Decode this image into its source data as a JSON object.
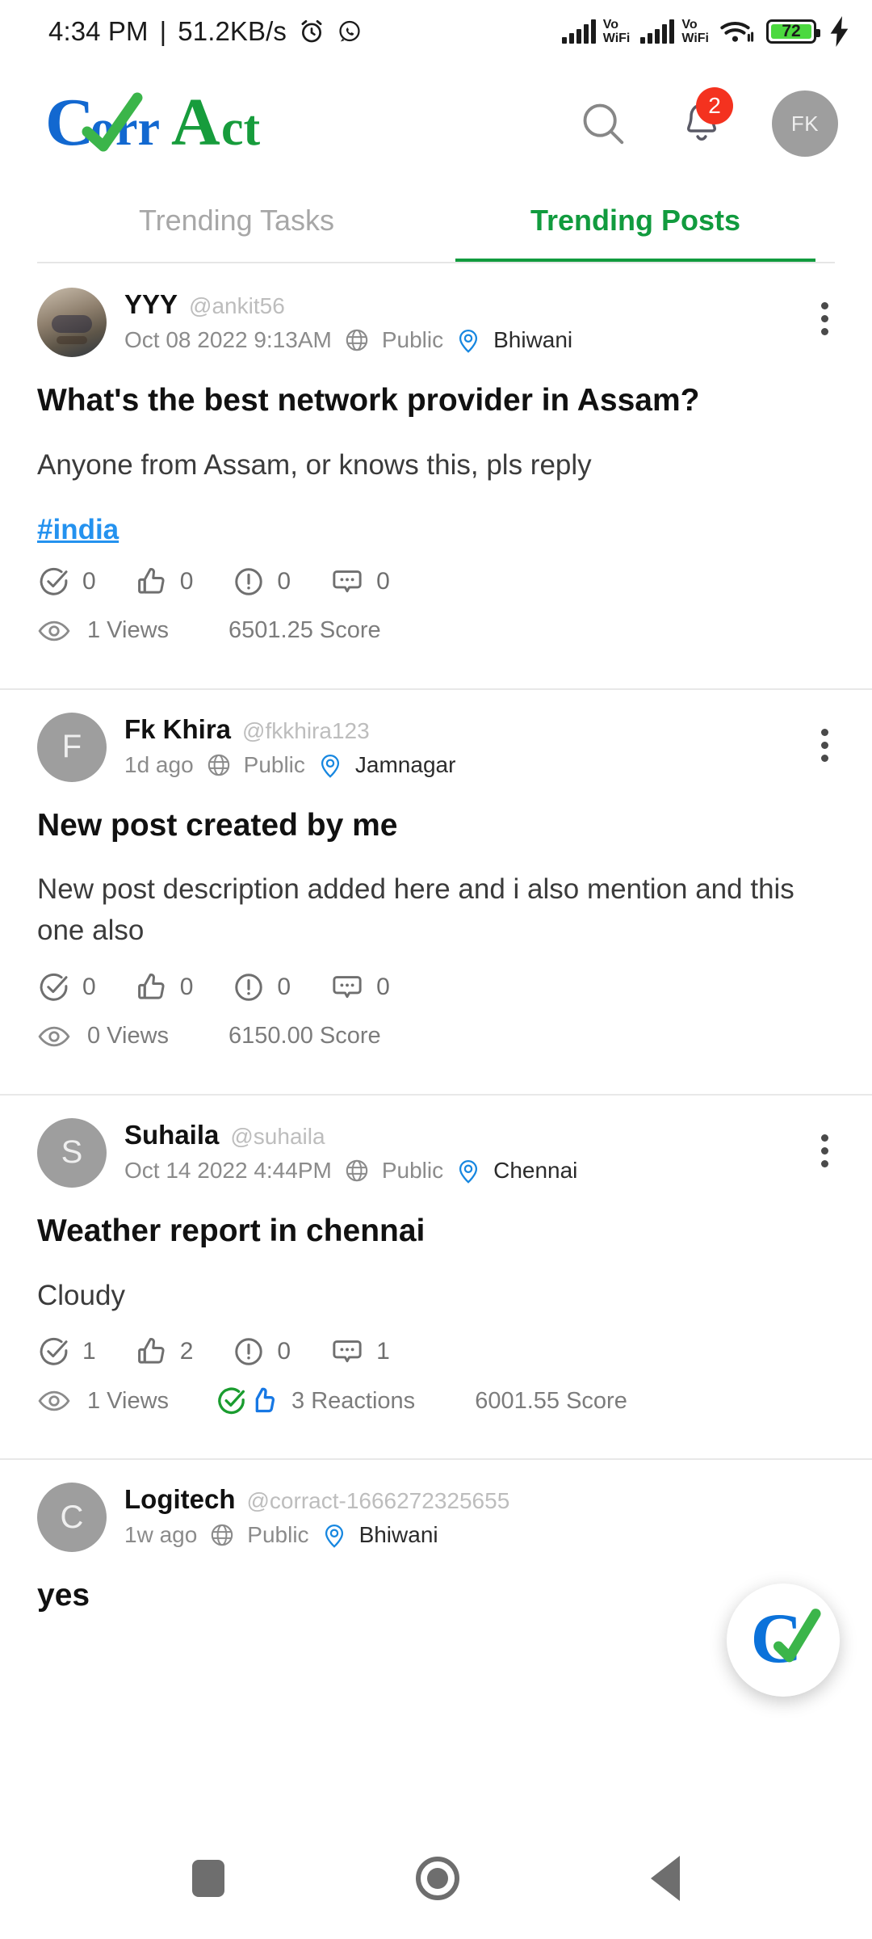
{
  "status_bar": {
    "time": "4:34 PM",
    "separator": "|",
    "network_speed": "51.2KB/s",
    "alarm_icon": "alarm-icon",
    "whatsapp_icon": "whatsapp-icon",
    "signal_1_label": "Vo\nWiFi",
    "signal_2_label": "Vo\nWiFi",
    "wifi_icon": "wifi-icon",
    "battery_percent": "72",
    "charging_icon": "charging-bolt-icon",
    "battery_color": "#4CD93F"
  },
  "header": {
    "logo_text": "CorrAct",
    "logo_blue": "#1268D0",
    "logo_green": "#179C3C",
    "search_label": "search-icon",
    "notifications_label": "notifications-bell-icon",
    "notification_count": "2",
    "badge_color": "#F4321F",
    "avatar_initials": "FK"
  },
  "tabs": [
    {
      "label": "Trending Tasks",
      "active": false
    },
    {
      "label": "Trending Posts",
      "active": true
    }
  ],
  "accent_green": "#119B3E",
  "link_blue": "#2492ef",
  "posts": [
    {
      "avatar_initial": "",
      "avatar_type": "photo",
      "name": "YYY",
      "handle": "@ankit56",
      "time": "Oct 08 2022 9:13AM",
      "visibility": "Public",
      "location": "Bhiwani",
      "title": "What's the best network provider in Assam?",
      "body": "Anyone from Assam, or knows this, pls reply",
      "hashtag": "#india",
      "reactions": {
        "verify": "0",
        "like": "0",
        "report": "0",
        "comment": "0"
      },
      "views": "1 Views",
      "score": "6501.25 Score",
      "reaction_summary": ""
    },
    {
      "avatar_initial": "F",
      "avatar_type": "initial",
      "name": "Fk Khira",
      "handle": "@fkkhira123",
      "time": "1d ago",
      "visibility": "Public",
      "location": "Jamnagar",
      "title": "New post created by me",
      "body": "New post description added here and i also mention and this one also",
      "hashtag": "",
      "reactions": {
        "verify": "0",
        "like": "0",
        "report": "0",
        "comment": "0"
      },
      "views": "0 Views",
      "score": "6150.00 Score",
      "reaction_summary": ""
    },
    {
      "avatar_initial": "S",
      "avatar_type": "initial",
      "name": "Suhaila",
      "handle": "@suhaila",
      "time": "Oct 14 2022 4:44PM",
      "visibility": "Public",
      "location": "Chennai",
      "title": "Weather report in chennai",
      "body": "Cloudy",
      "hashtag": "",
      "reactions": {
        "verify": "1",
        "like": "2",
        "report": "0",
        "comment": "1"
      },
      "views": "1 Views",
      "score": "6001.55 Score",
      "reaction_summary": "3 Reactions"
    },
    {
      "avatar_initial": "C",
      "avatar_type": "initial",
      "name": "Logitech",
      "handle": "@corract-1666272325655",
      "time": "1w ago",
      "visibility": "Public",
      "location": "Bhiwani",
      "title": "yes",
      "body": "",
      "hashtag": "",
      "reactions": {
        "verify": "",
        "like": "",
        "report": "",
        "comment": ""
      },
      "views": "",
      "score": "",
      "reaction_summary": ""
    }
  ],
  "fab": {
    "label": "create-post-fab"
  },
  "nav_bar": {
    "recents_label": "recents-button",
    "home_label": "home-button",
    "back_label": "back-button"
  }
}
